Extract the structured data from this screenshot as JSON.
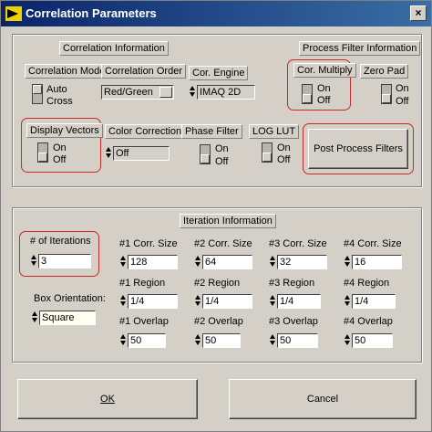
{
  "window": {
    "title": "Correlation Parameters",
    "close_glyph": "×"
  },
  "sections": {
    "correlation_info": "Correlation Information",
    "process_filter_info": "Process Filter Information",
    "iteration_info": "Iteration Information"
  },
  "correlation_mode": {
    "label": "Correlation Mode",
    "options": [
      "Auto",
      "Cross"
    ],
    "selected": "Auto"
  },
  "correlation_order": {
    "label": "Correlation Order",
    "value": "Red/Green"
  },
  "cor_engine": {
    "label": "Cor. Engine",
    "value": "IMAQ 2D"
  },
  "cor_multiply": {
    "label": "Cor. Multiply",
    "on": "On",
    "off": "Off",
    "state": "Off"
  },
  "zero_pad": {
    "label": "Zero Pad",
    "on": "On",
    "off": "Off",
    "state": "Off"
  },
  "display_vectors": {
    "label": "Display Vectors",
    "on": "On",
    "off": "Off",
    "state": "Off"
  },
  "color_correction": {
    "label": "Color Correction",
    "value": "Off"
  },
  "phase_filter": {
    "label": "Phase Filter",
    "on": "On",
    "off": "Off",
    "state": "Off"
  },
  "log_lut": {
    "label": "LOG LUT",
    "on": "On",
    "off": "Off",
    "state": "Off"
  },
  "post_process_button": "Post Process Filters",
  "iterations": {
    "label": "# of Iterations",
    "value": "3"
  },
  "box_orientation": {
    "label": "Box Orientation:",
    "value": "Square"
  },
  "grid": [
    {
      "corr_label": "#1 Corr. Size",
      "corr_value": "128",
      "region_label": "#1 Region",
      "region_value": "1/4",
      "overlap_label": "#1 Overlap",
      "overlap_value": "50"
    },
    {
      "corr_label": "#2 Corr. Size",
      "corr_value": "64",
      "region_label": "#2 Region",
      "region_value": "1/4",
      "overlap_label": "#2 Overlap",
      "overlap_value": "50"
    },
    {
      "corr_label": "#3 Corr. Size",
      "corr_value": "32",
      "region_label": "#3 Region",
      "region_value": "1/4",
      "overlap_label": "#3 Overlap",
      "overlap_value": "50"
    },
    {
      "corr_label": "#4 Corr. Size",
      "corr_value": "16",
      "region_label": "#4 Region",
      "region_value": "1/4",
      "overlap_label": "#4 Overlap",
      "overlap_value": "50"
    }
  ],
  "buttons": {
    "ok": "OK",
    "cancel": "Cancel"
  },
  "colors": {
    "title_start": "#0a246a",
    "title_end": "#3a6ea5",
    "highlight": "#c82828",
    "face": "#d4d0c8"
  }
}
